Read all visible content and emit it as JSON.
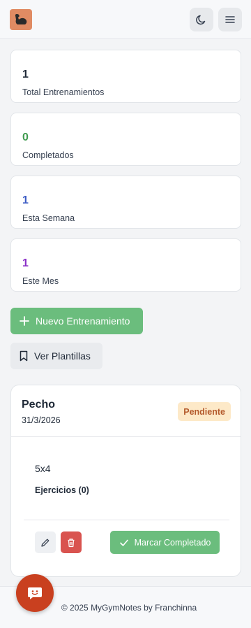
{
  "colors": {
    "accent_green": "#6bbd7d",
    "danger_red": "#d9534f",
    "badge_bg": "#fde9c8",
    "badge_text": "#b45a2c",
    "fab": "#c9401f",
    "logo": "#e08b63"
  },
  "header": {
    "logo_icon": "flexed-arm-icon",
    "theme_icon": "moon-icon",
    "menu_icon": "hamburger-menu-icon"
  },
  "stats": [
    {
      "value": "1",
      "label": "Total Entrenamientos",
      "color": "#1f2937"
    },
    {
      "value": "0",
      "label": "Completados",
      "color": "#3f9a4f"
    },
    {
      "value": "1",
      "label": "Esta Semana",
      "color": "#3c5cc4"
    },
    {
      "value": "1",
      "label": "Este Mes",
      "color": "#8a2fc7"
    }
  ],
  "actions": {
    "new_workout": "Nuevo Entrenamiento",
    "templates": "Ver Plantillas"
  },
  "workout": {
    "title": "Pecho",
    "date": "31/3/2026",
    "status": "Pendiente",
    "reps": "5x4",
    "exercises": "Ejercicios (0)",
    "complete_label": "Marcar Completado"
  },
  "footer": {
    "text": "© 2025 MyGymNotes by Franchinna",
    "fab_icon": "smiley-chat-icon"
  }
}
